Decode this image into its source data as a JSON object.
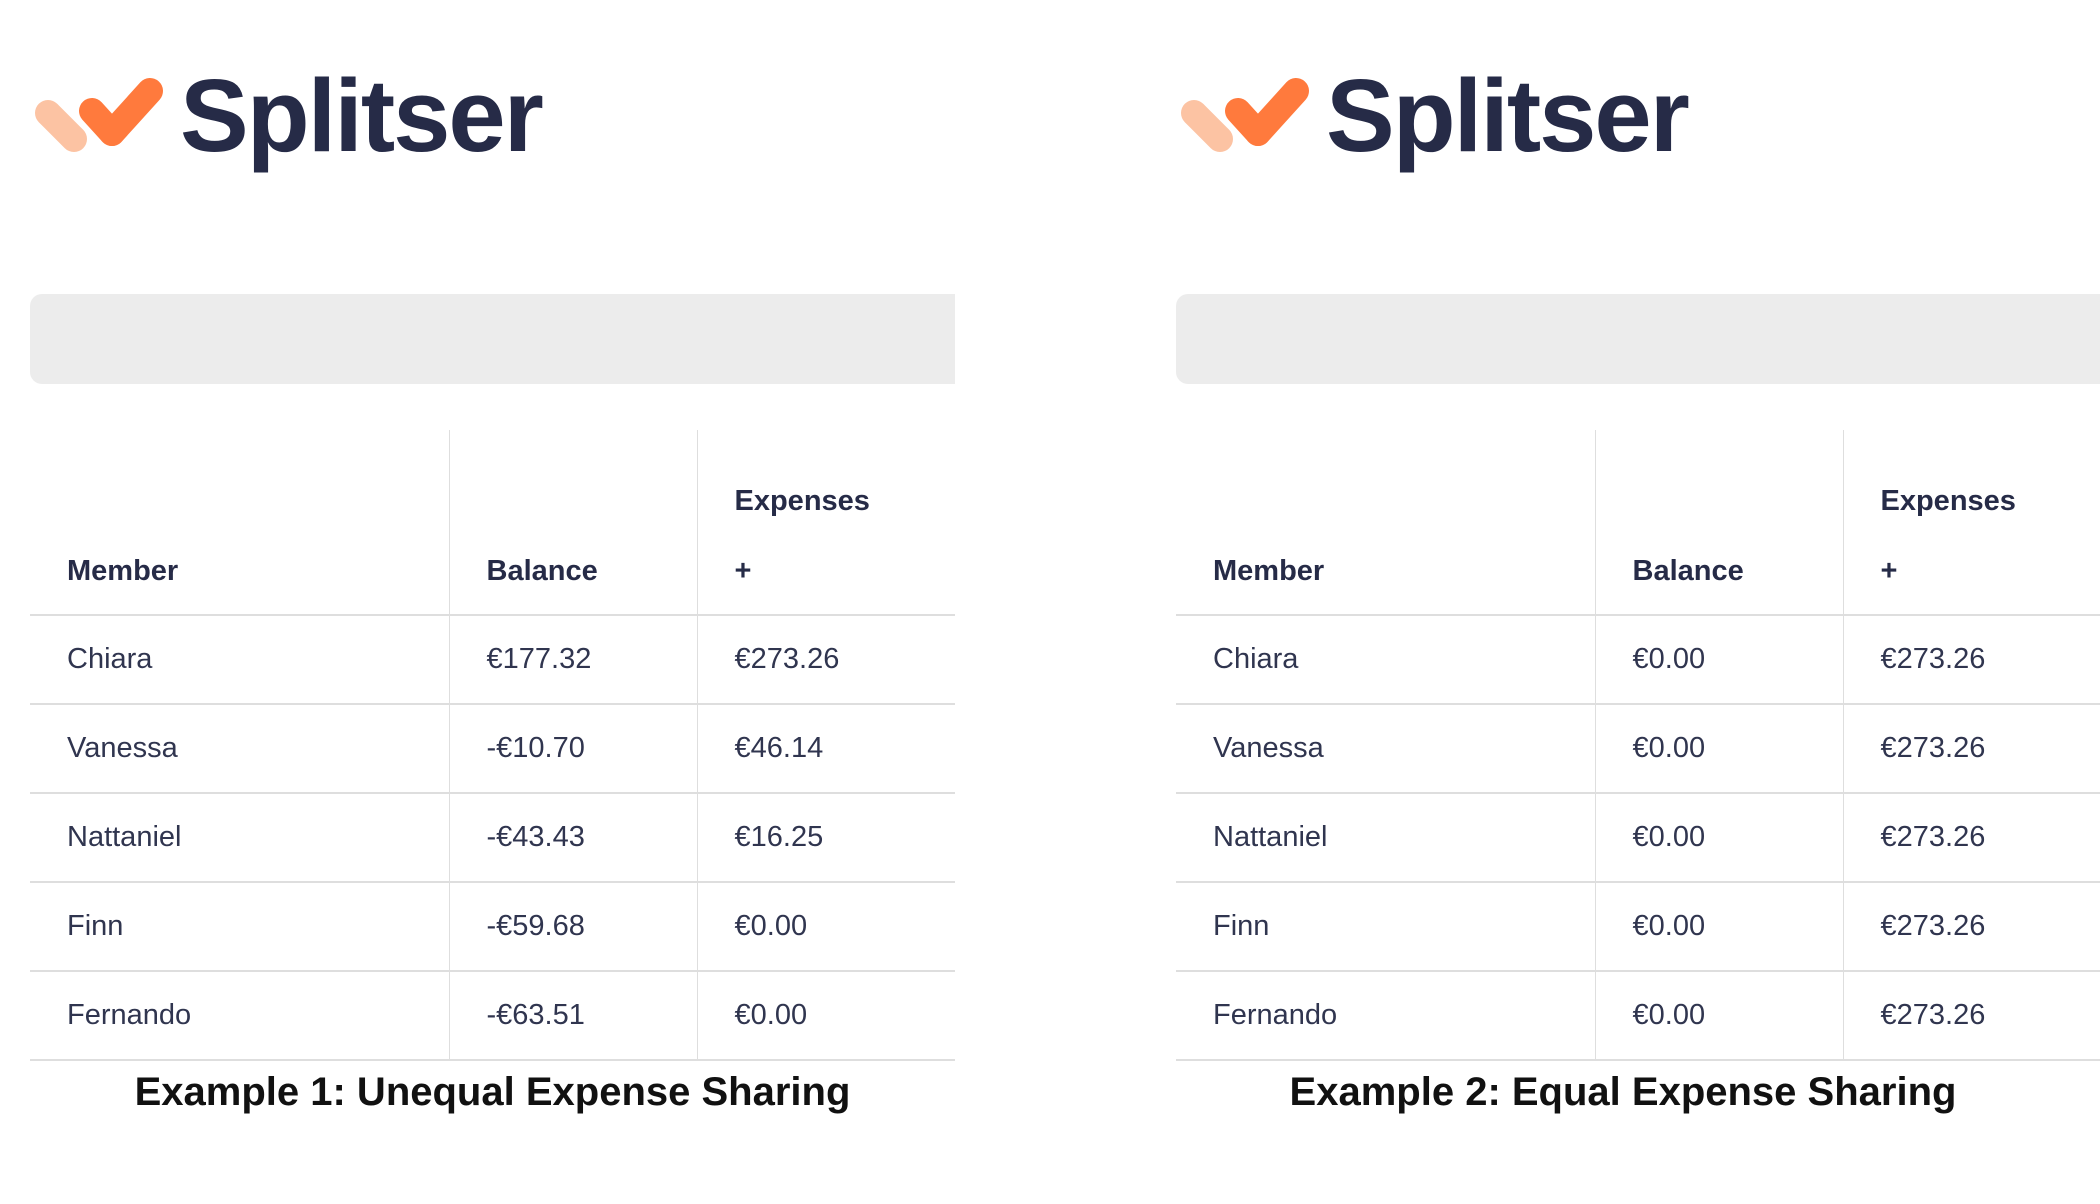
{
  "logo": {
    "text": "Splitser"
  },
  "colors": {
    "brand_orange": "#ff7a3d",
    "brand_peach": "#fcc3a3",
    "brand_navy": "#262b47",
    "bar_gray": "#ececec"
  },
  "columns": {
    "member": "Member",
    "balance": "Balance",
    "expenses": "Expenses",
    "expenses_add": "+"
  },
  "example1": {
    "caption": "Example 1: Unequal Expense Sharing",
    "rows": [
      {
        "member": "Chiara",
        "balance": "€177.32",
        "expenses": "€273.26"
      },
      {
        "member": "Vanessa",
        "balance": "-€10.70",
        "expenses": "€46.14"
      },
      {
        "member": "Nattaniel",
        "balance": "-€43.43",
        "expenses": "€16.25"
      },
      {
        "member": "Finn",
        "balance": "-€59.68",
        "expenses": "€0.00"
      },
      {
        "member": "Fernando",
        "balance": "-€63.51",
        "expenses": "€0.00"
      }
    ]
  },
  "example2": {
    "caption": "Example 2: Equal Expense Sharing",
    "rows": [
      {
        "member": "Chiara",
        "balance": "€0.00",
        "expenses": "€273.26"
      },
      {
        "member": "Vanessa",
        "balance": "€0.00",
        "expenses": "€273.26"
      },
      {
        "member": "Nattaniel",
        "balance": "€0.00",
        "expenses": "€273.26"
      },
      {
        "member": "Finn",
        "balance": "€0.00",
        "expenses": "€273.26"
      },
      {
        "member": "Fernando",
        "balance": "€0.00",
        "expenses": "€273.26"
      }
    ]
  }
}
